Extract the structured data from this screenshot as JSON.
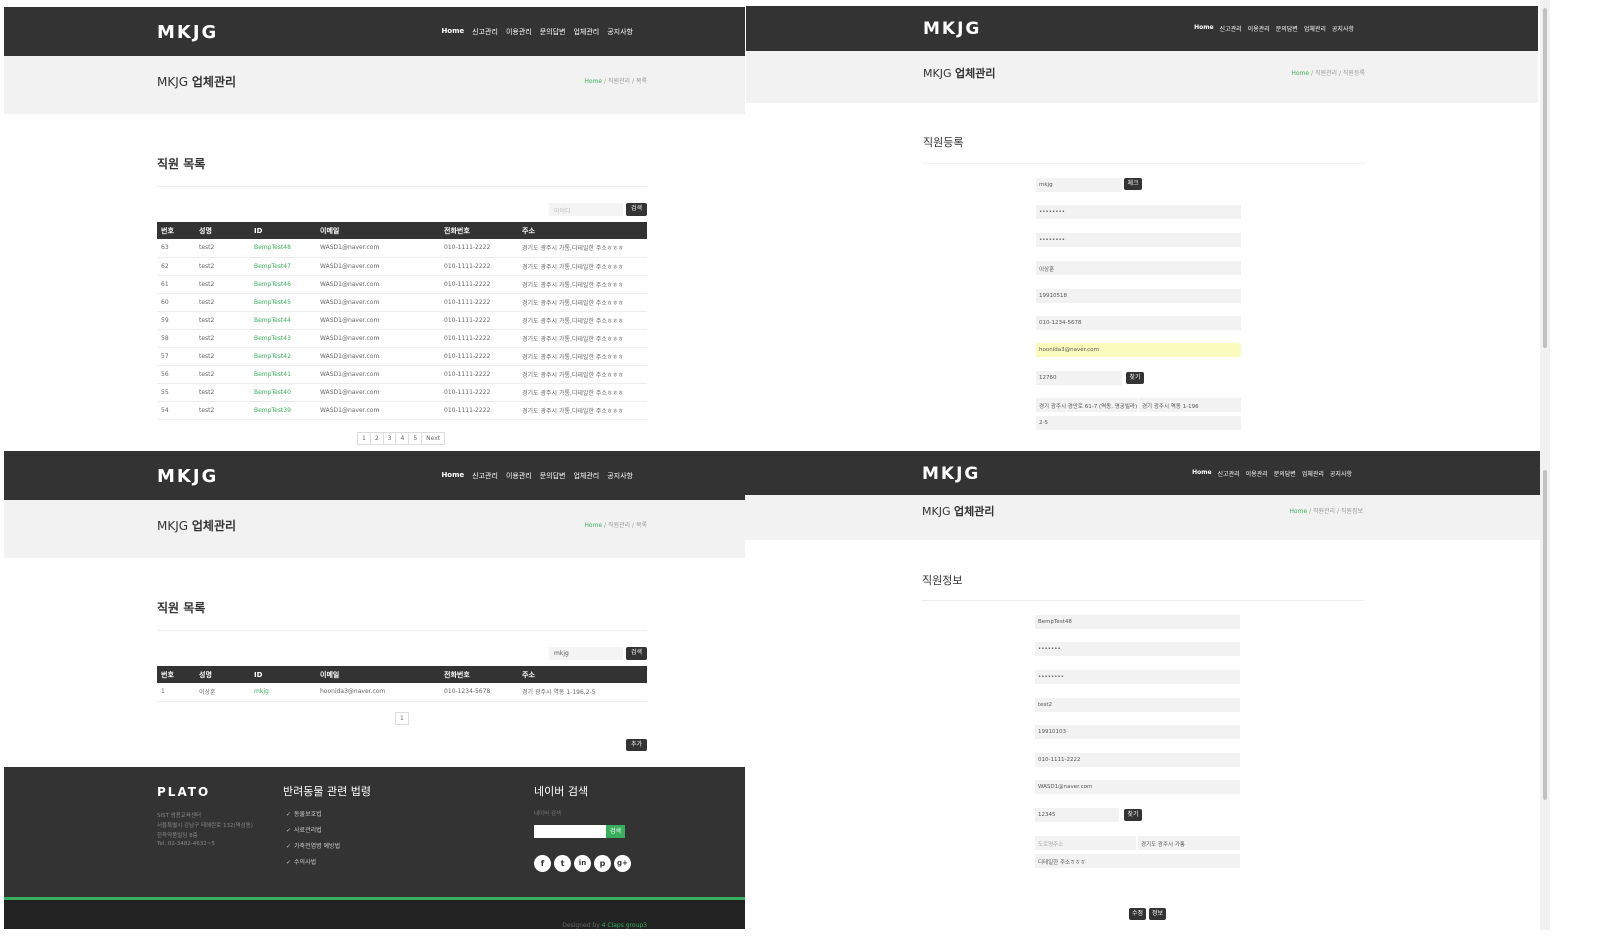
{
  "header": {
    "logo": "MKJG",
    "nav": [
      "Home",
      "신고관리",
      "이용관리",
      "문의답변",
      "업체관리",
      "공지사항"
    ]
  },
  "band": {
    "title_prefix": "MKJG ",
    "title_bold": "업체관리"
  },
  "breadcrumb": {
    "home": "Home",
    "sep": "/",
    "list_section": "직원관리",
    "list_page": "목록",
    "register_page": "직원등록",
    "info_page": "직원정보"
  },
  "list_top": {
    "section_title": "직원 목록",
    "search_placeholder": "아이디",
    "search_button": "검색",
    "columns": [
      "번호",
      "성명",
      "ID",
      "이메일",
      "전화번호",
      "주소"
    ],
    "rows": [
      [
        "63",
        "test2",
        "BempTest48",
        "WASD1@naver.com",
        "010-1111-2222",
        "경기도 광주시 가통,디테일한 주소ㅎㅎㅎ"
      ],
      [
        "62",
        "test2",
        "BempTest47",
        "WASD1@naver.com",
        "010-1111-2222",
        "경기도 광주시 가통,디테일한 주소ㅎㅎㅎ"
      ],
      [
        "61",
        "test2",
        "BempTest46",
        "WASD1@naver.com",
        "010-1111-2222",
        "경기도 광주시 가통,디테일한 주소ㅎㅎㅎ"
      ],
      [
        "60",
        "test2",
        "BempTest45",
        "WASD1@naver.com",
        "010-1111-2222",
        "경기도 광주시 가통,디테일한 주소ㅎㅎㅎ"
      ],
      [
        "59",
        "test2",
        "BempTest44",
        "WASD1@naver.com",
        "010-1111-2222",
        "경기도 광주시 가통,디테일한 주소ㅎㅎㅎ"
      ],
      [
        "58",
        "test2",
        "BempTest43",
        "WASD1@naver.com",
        "010-1111-2222",
        "경기도 광주시 가통,디테일한 주소ㅎㅎㅎ"
      ],
      [
        "57",
        "test2",
        "BempTest42",
        "WASD1@naver.com",
        "010-1111-2222",
        "경기도 광주시 가통,디테일한 주소ㅎㅎㅎ"
      ],
      [
        "56",
        "test2",
        "BempTest41",
        "WASD1@naver.com",
        "010-1111-2222",
        "경기도 광주시 가통,디테일한 주소ㅎㅎㅎ"
      ],
      [
        "55",
        "test2",
        "BempTest40",
        "WASD1@naver.com",
        "010-1111-2222",
        "경기도 광주시 가통,디테일한 주소ㅎㅎㅎ"
      ],
      [
        "54",
        "test2",
        "BempTest39",
        "WASD1@naver.com",
        "010-1111-2222",
        "경기도 광주시 가통,디테일한 주소ㅎㅎㅎ"
      ]
    ],
    "pages": [
      "1",
      "2",
      "3",
      "4",
      "5",
      "Next"
    ]
  },
  "register": {
    "section_title": "직원등록",
    "id_value": "mkjg",
    "check_button": "체크",
    "password": "••••••••",
    "password_confirm": "••••••••",
    "name": "이상훈",
    "birth": "19910518",
    "phone": "010-1234-5678",
    "email": "hoonida3@naver.com",
    "zipcode": "12760",
    "find_button": "찾기",
    "road_address": "경기 광주시 경안로 61-7 (역동, 명궁빌라)",
    "jibun_address": "경기 광주시 역동 1-196",
    "detail_address": "2-5"
  },
  "list_bottom": {
    "section_title": "직원 목록",
    "search_value": "mkjg",
    "search_button": "검색",
    "columns": [
      "번호",
      "성명",
      "ID",
      "이메일",
      "전화번호",
      "주소"
    ],
    "rows": [
      [
        "1",
        "이상훈",
        "mkjg",
        "hoonida3@naver.com",
        "010-1234-5678",
        "경기 광주시 역동 1-196,2-5"
      ]
    ],
    "pages": [
      "1"
    ],
    "add_button": "추가"
  },
  "footer": {
    "logo": "PLATO",
    "address_lines": [
      "SIST 쌍용교육센터",
      "서울특별시 강남구 테헤란로 132(역삼동)",
      "한독약품빌딩 8층"
    ],
    "tel": "Tel. 02-3482-4632~5",
    "law_title": "반려동물 관련 법령",
    "laws": [
      "동물보호법",
      "사료관리법",
      "가축전염병 예방법",
      "수의사법"
    ],
    "search_title": "네이버 검색",
    "search_label": "네이버 검색",
    "search_button": "검색",
    "social": [
      "f",
      "t",
      "in",
      "p",
      "g+"
    ],
    "designed_by": "Designed by ",
    "designer": "4 Claps group3"
  },
  "info": {
    "section_title": "직원정보",
    "id_value": "BempTest48",
    "password": "•••••••",
    "password_confirm": "••••••••",
    "name": "test2",
    "birth": "19910103",
    "phone": "010-1111-2222",
    "email": "WASD1@naver.com",
    "zipcode": "12345",
    "find_button": "찾기",
    "road_placeholder": "도로명주소",
    "jibun_address": "경기도 광주시 가통",
    "detail_address": "디테일한 주소ㅎㅎㅎ",
    "edit_button": "수정",
    "delete_button": "정보"
  },
  "colors": {
    "header_bg": "#333333",
    "accent_green": "#3aae5f",
    "band_bg": "#f2f2f2",
    "highlight_field": "#fbfbbe"
  }
}
